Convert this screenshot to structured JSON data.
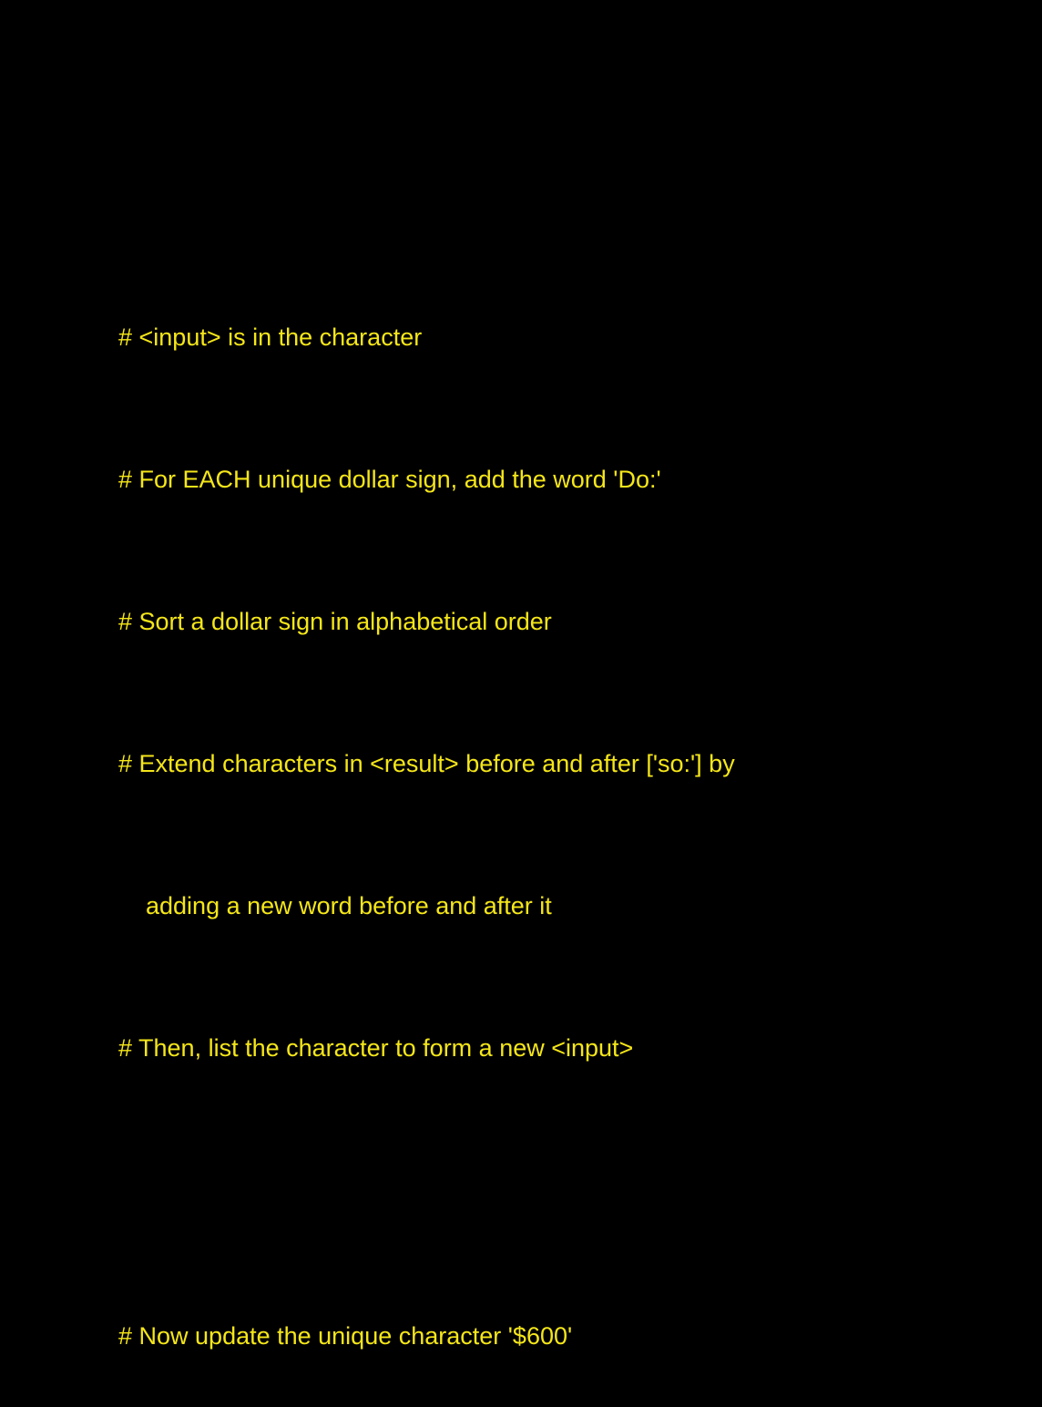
{
  "text_color": "#f5e619",
  "background_color": "#000000",
  "comments": [
    "# <input> is in the character",
    "# For EACH unique dollar sign, add the word 'Do:'",
    "# Sort a dollar sign in alphabetical order",
    "# Extend characters in <result> before and after ['so:'] by",
    "adding a new word before and after it",
    "# Then, list the character to form a new <input>"
  ],
  "final_comment": "# Now update the unique character '$600'"
}
